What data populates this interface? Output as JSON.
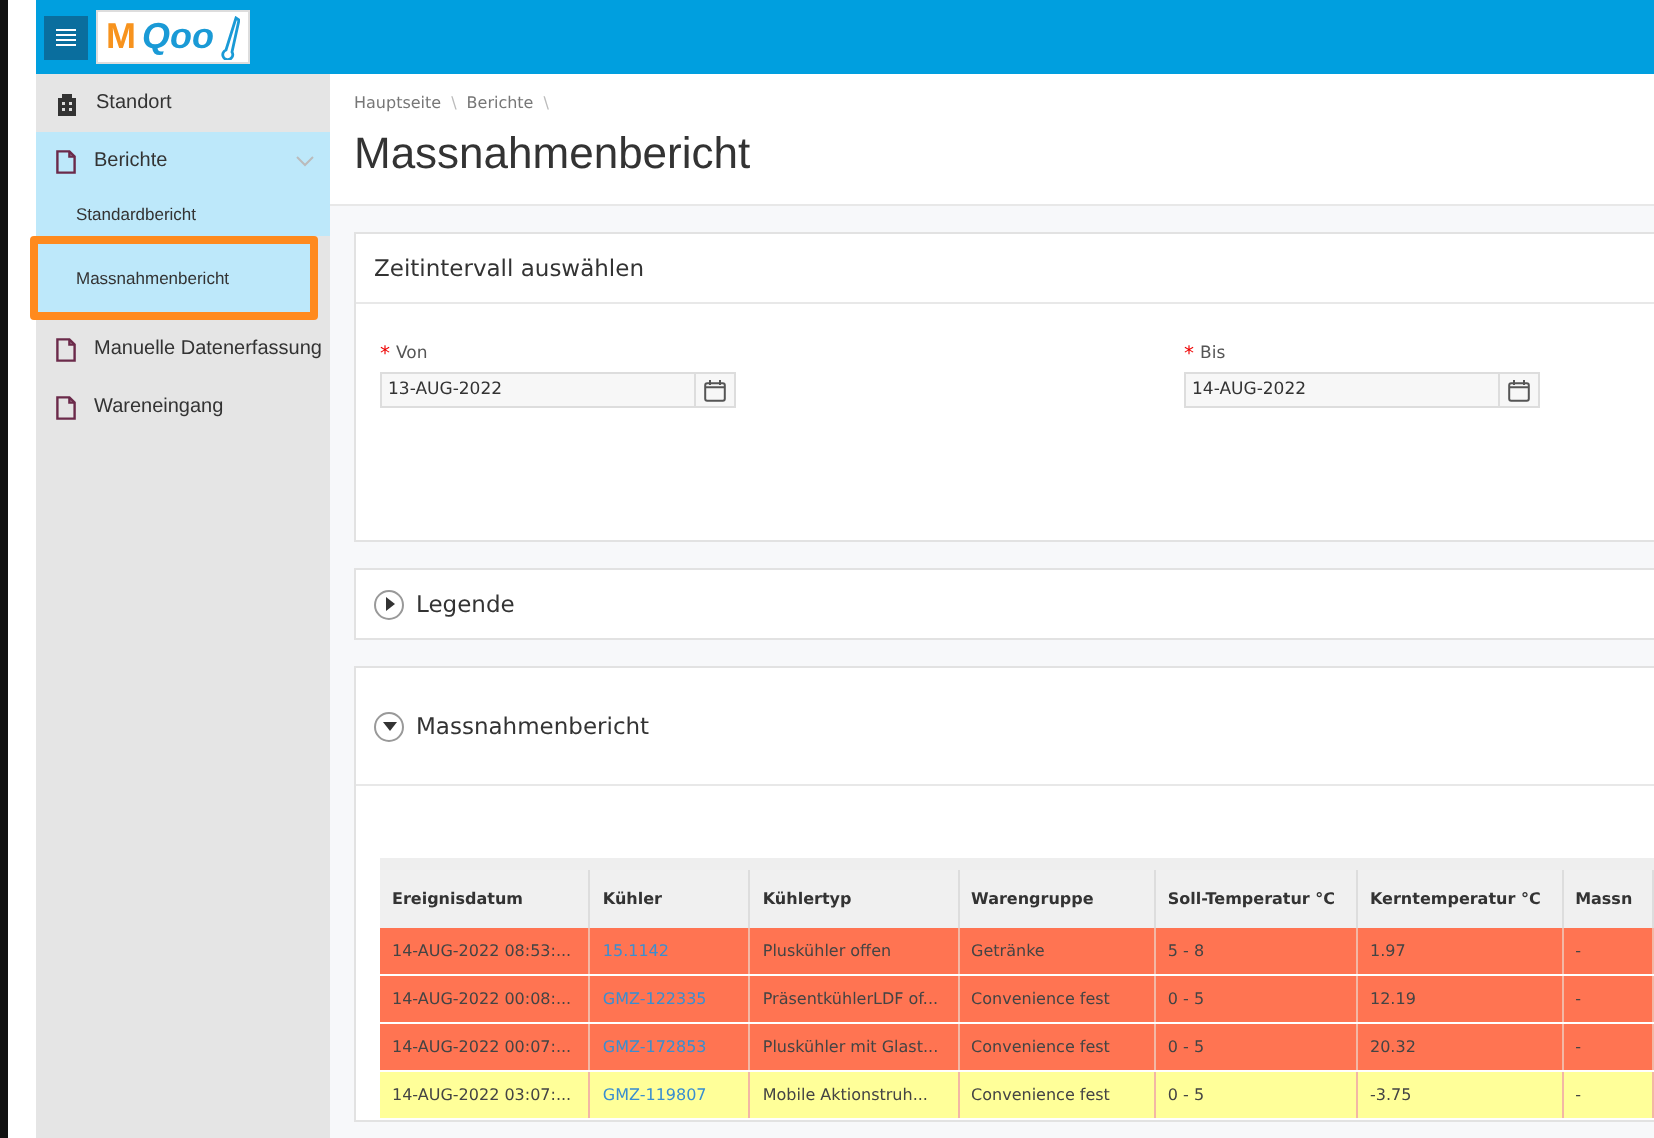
{
  "header": {
    "logo_letter": "M",
    "logo_text": "Qoo"
  },
  "sidebar": {
    "items": [
      {
        "label": "Standort",
        "expanded": false
      },
      {
        "label": "Berichte",
        "expanded": true,
        "children": [
          {
            "label": "Standardbericht",
            "highlighted": false
          },
          {
            "label": "Massnahmenbericht",
            "highlighted": true
          }
        ]
      },
      {
        "label": "Manuelle Datenerfassung",
        "expanded": false
      },
      {
        "label": "Wareneingang",
        "expanded": false
      }
    ]
  },
  "breadcrumb": [
    {
      "label": "Hauptseite",
      "separator": "\\"
    },
    {
      "label": "Berichte",
      "separator": "\\"
    }
  ],
  "page_title": "Massnahmenbericht",
  "interval_panel": {
    "title": "Zeitintervall auswählen",
    "fields": [
      {
        "label": "Von",
        "required_mark": "*",
        "value": "13-AUG-2022"
      },
      {
        "label": "Bis",
        "required_mark": "*",
        "value": "14-AUG-2022"
      }
    ]
  },
  "legend_panel": {
    "title": "Legende",
    "expanded": false
  },
  "report_panel": {
    "title": "Massnahmenbericht",
    "expanded": true
  },
  "table": {
    "columns": [
      "Ereignisdatum",
      "Kühler",
      "Kühlertyp",
      "Warengruppe",
      "Soll-Temperatur °C",
      "Kerntemperatur °C",
      "Massn"
    ],
    "rows": [
      {
        "color": "#ff7452",
        "cells": [
          "14-AUG-2022 08:53:...",
          "15.1142",
          "Pluskühler offen",
          "Getränke",
          "5 - 8",
          "1.97",
          "-"
        ]
      },
      {
        "color": "#ff7452",
        "cells": [
          "14-AUG-2022 00:08:...",
          "GMZ-122335",
          "PräsentkühlerLDF of...",
          "Convenience fest",
          "0 - 5",
          "12.19",
          "-"
        ]
      },
      {
        "color": "#ff7452",
        "cells": [
          "14-AUG-2022 00:07:...",
          "GMZ-172853",
          "Pluskühler mit Glast...",
          "Convenience fest",
          "0 - 5",
          "20.32",
          "-"
        ]
      },
      {
        "color": "#ffff99",
        "cells": [
          "14-AUG-2022 03:07:...",
          "GMZ-119807",
          "Mobile Aktionstruh...",
          "Convenience fest",
          "0 - 5",
          "-3.75",
          "-"
        ]
      }
    ]
  }
}
